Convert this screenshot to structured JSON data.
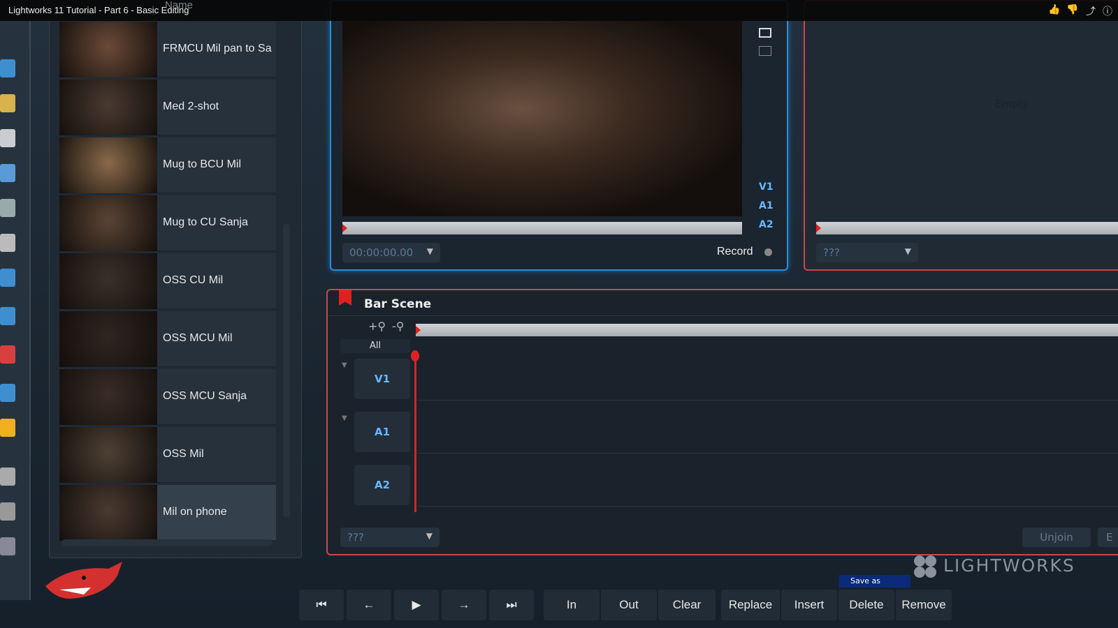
{
  "video_title": "Lightworks 11 Tutorial - Part 6 - Basic Editing",
  "bin": {
    "header": "Name",
    "clips": [
      "FRMCU Mil pan to Sa",
      "Med 2-shot",
      "Mug to BCU Mil",
      "Mug to CU Sanja",
      "OSS CU Mil",
      "OSS MCU Mil",
      "OSS MCU Sanja",
      "OSS Mil",
      "Mil on phone"
    ],
    "selected": "Mil on phone"
  },
  "viewer": {
    "timecode": "00:00:00.00",
    "tracks": [
      "V1",
      "A1",
      "A2"
    ],
    "record_label": "Record",
    "playhead_fraction": 0
  },
  "record_viewer": {
    "timecode": "???",
    "empty_label": "Empty"
  },
  "timeline": {
    "title": "Bar Scene",
    "all_label": "All",
    "tracks": [
      "V1",
      "A1",
      "A2"
    ],
    "timecode": "???",
    "unjoin_label": "Unjoin",
    "cut_label": "E"
  },
  "logo": "LIGHTWORKS",
  "tooltip": "Save as",
  "transport": {
    "buttons": [
      "In",
      "Out",
      "Clear",
      "Replace",
      "Insert",
      "Delete",
      "Remove"
    ]
  },
  "colors": {
    "accent_blue": "#2a8ed8",
    "accent_red": "#c84848",
    "playhead": "#e02020"
  }
}
